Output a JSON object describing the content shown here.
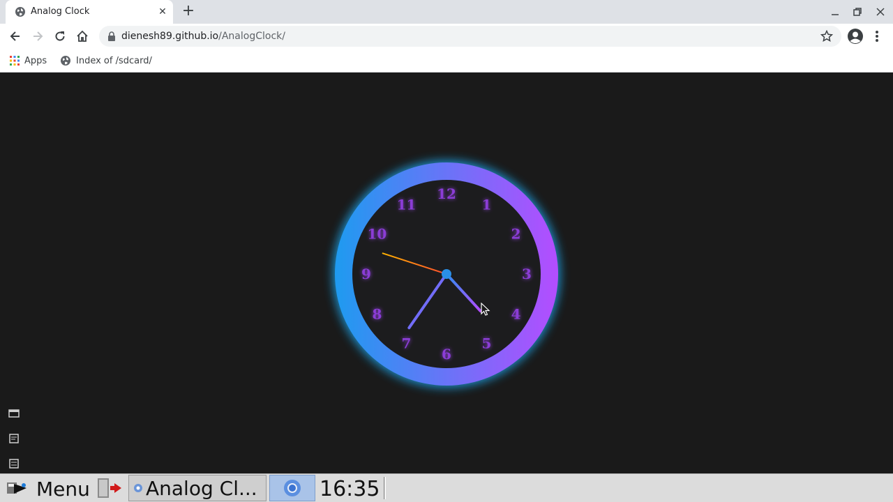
{
  "browser": {
    "tab_title": "Analog Clock",
    "url_host": "dienesh89.github.io",
    "url_path": "/AnalogClock/",
    "bookmarks": [
      {
        "label": "Apps",
        "icon": "apps-grid-icon"
      },
      {
        "label": "Index of /sdcard/",
        "icon": "globe-icon"
      }
    ]
  },
  "clock": {
    "numerals": [
      "12",
      "1",
      "2",
      "3",
      "4",
      "5",
      "6",
      "7",
      "8",
      "9",
      "10",
      "11"
    ],
    "hour": 4,
    "minute": 35,
    "second": 48,
    "colors": {
      "ring_start": "#1e9bf0",
      "ring_end": "#b44dff",
      "numeral": "#8b3dd6",
      "face": "#1a1a1a",
      "second_hand_start": "#ffb300",
      "second_hand_end": "#ff4d2e"
    }
  },
  "taskbar": {
    "menu_label": "Menu",
    "task_label": "Analog Cl...",
    "time": "16:35"
  }
}
